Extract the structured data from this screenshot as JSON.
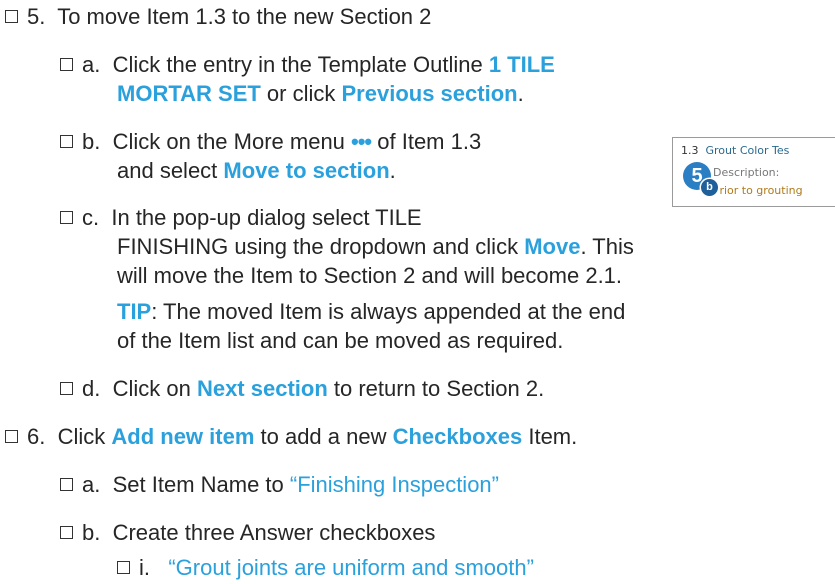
{
  "steps": [
    {
      "num": "5.",
      "text": "To move Item 1.3 to the new Section 2",
      "substeps": [
        {
          "label": "a.",
          "pre": "Click the entry in the Template Outline ",
          "hl1": "1 TILE",
          "hl2": "MORTAR SET",
          "mid": " or click ",
          "hl3": "Previous section",
          "post": "."
        },
        {
          "label": "b.",
          "pre": "Click on the More menu ",
          "dots": "•••",
          "mid": " of Item 1.3",
          "line2_pre": "and select ",
          "hl": "Move to section",
          "post": "."
        },
        {
          "label": "c.",
          "line1": "In the pop-up dialog select TILE",
          "line2_pre": "FINISHING using the dropdown and click ",
          "hl": "Move",
          "line2_post": ". This",
          "line3": "will move the Item to Section 2 and will become 2.1.",
          "tip_label": "TIP",
          "tip_line1": ": The moved Item is always appended at the end",
          "tip_line2": "of the Item list and can be moved as required."
        },
        {
          "label": "d.",
          "pre": "Click on ",
          "hl": "Next section",
          "post": " to return to Section 2."
        }
      ]
    },
    {
      "num": "6.",
      "pre": "Click ",
      "hl1": "Add new item",
      "mid": " to add a new ",
      "hl2": "Checkboxes",
      "post": " Item.",
      "substeps": [
        {
          "label": "a.",
          "pre": "Set Item Name to ",
          "quoted": "“Finishing Inspection”"
        },
        {
          "label": "b.",
          "text": "Create three Answer checkboxes"
        }
      ],
      "subsubsteps": [
        {
          "label": "i.",
          "quoted": "“Grout joints are uniform and smooth”"
        }
      ]
    }
  ],
  "thumbnail": {
    "item_number": "1.3",
    "item_name": "Grout Color Tes",
    "description_label": "Description:",
    "description_text": "Prior to grouting",
    "badge_number": "5",
    "badge_letter": "b"
  },
  "colors": {
    "accent": "#2aa0dc",
    "text": "#262626",
    "badge": "#2a7fc4"
  }
}
